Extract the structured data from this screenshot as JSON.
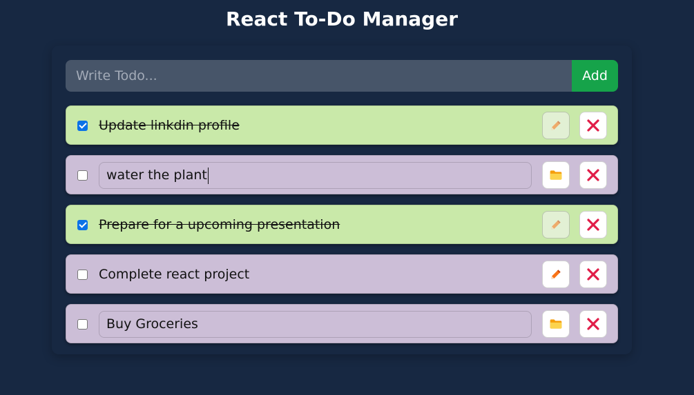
{
  "app": {
    "title": "React To-Do Manager"
  },
  "add_form": {
    "placeholder": "Write Todo...",
    "value": "",
    "button_label": "Add"
  },
  "todos": [
    {
      "text": "Update linkdin profile",
      "completed": true,
      "editing": false,
      "action_icon": "pencil-icon"
    },
    {
      "text": "water the plant",
      "completed": false,
      "editing": true,
      "action_icon": "folder-icon"
    },
    {
      "text": "Prepare for a upcoming presentation",
      "completed": true,
      "editing": false,
      "action_icon": "pencil-icon"
    },
    {
      "text": "Complete react project",
      "completed": false,
      "editing": false,
      "action_icon": "pencil-icon"
    },
    {
      "text": "Buy Groceries",
      "completed": false,
      "editing": true,
      "action_icon": "folder-icon"
    }
  ],
  "colors": {
    "background": "#172842",
    "completed_row": "#c9e9a9",
    "open_row": "#ccbed7",
    "add_button": "#16a34a",
    "delete_icon": "#e11d48",
    "pencil_icon": "#f97316",
    "folder_icon": "#fbbf24"
  }
}
